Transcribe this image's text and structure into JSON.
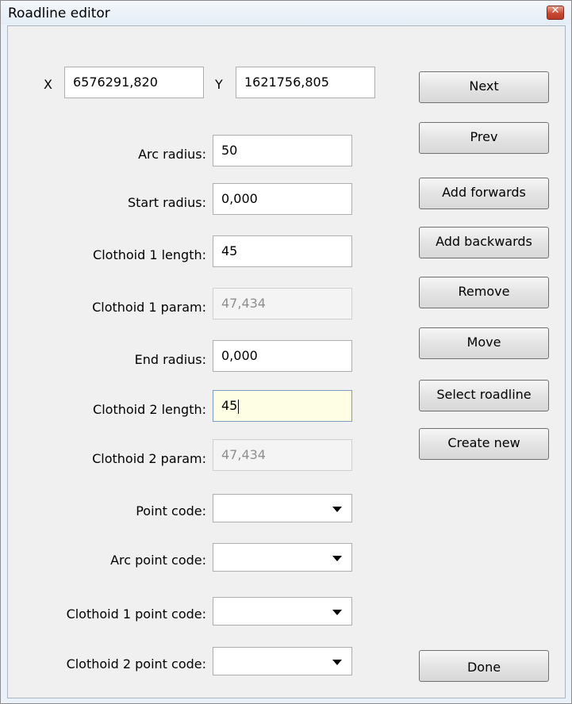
{
  "window": {
    "title": "Roadline editor",
    "close_icon": "close-icon"
  },
  "coords": {
    "x_label": "X",
    "x_value": "6576291,820",
    "y_label": "Y",
    "y_value": "1621756,805"
  },
  "fields": {
    "arc_radius": {
      "label": "Arc radius:",
      "value": "50"
    },
    "start_radius": {
      "label": "Start radius:",
      "value": "0,000"
    },
    "clothoid1_length": {
      "label": "Clothoid 1 length:",
      "value": "45"
    },
    "clothoid1_param": {
      "label": "Clothoid 1 param:",
      "value": "47,434"
    },
    "end_radius": {
      "label": "End radius:",
      "value": "0,000"
    },
    "clothoid2_length": {
      "label": "Clothoid 2 length:",
      "value": "45"
    },
    "clothoid2_param": {
      "label": "Clothoid 2 param:",
      "value": "47,434"
    },
    "point_code": {
      "label": "Point code:",
      "value": ""
    },
    "arc_point_code": {
      "label": "Arc point code:",
      "value": ""
    },
    "clothoid1_point_code": {
      "label": "Clothoid 1 point code:",
      "value": ""
    },
    "clothoid2_point_code": {
      "label": "Clothoid 2 point code:",
      "value": ""
    }
  },
  "buttons": {
    "next": "Next",
    "prev": "Prev",
    "add_forwards": "Add forwards",
    "add_backwards": "Add backwards",
    "remove": "Remove",
    "move": "Move",
    "select_roadline": "Select roadline",
    "create_new": "Create new",
    "done": "Done"
  },
  "colors": {
    "active_field_bg": "#fefee4",
    "close_button": "#c94a33"
  }
}
